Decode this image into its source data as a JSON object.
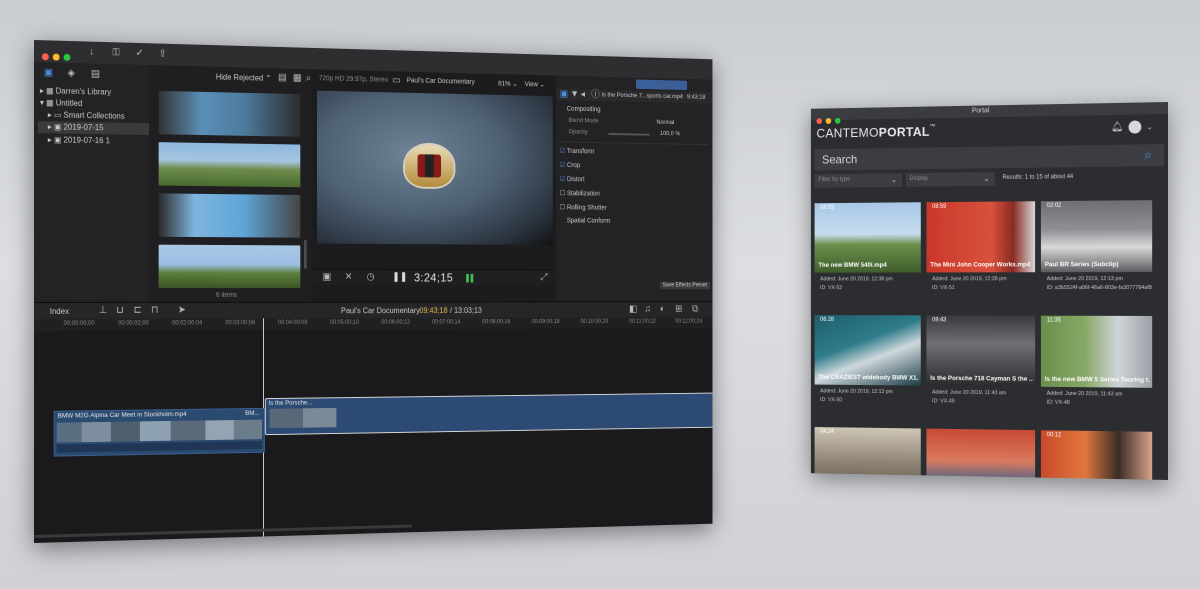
{
  "fcp": {
    "browser": {
      "filter_label": "Hide Rejected",
      "filter_chevron": "⌃",
      "library": "Darren's Library",
      "event_untitled": "Untitled",
      "smart_collections": "Smart Collections",
      "date1": "2019-07-15",
      "date2": "2019-07-16 1",
      "items_count": "6 items"
    },
    "viewer": {
      "format": "720p HD 29.97p, Stereo",
      "project": "Paul's Car Documentary",
      "zoom": "81%",
      "view": "View",
      "timecode": "3:24;15"
    },
    "inspector": {
      "clip_name": "Is the Porsche 7...sports car.mp4",
      "clip_time": "9:43;18",
      "compositing": "Compositing",
      "blend_mode_label": "Blend Mode",
      "blend_mode_value": "Normal",
      "opacity_label": "Opacity",
      "opacity_value": "100,0 %",
      "transform": "Transform",
      "crop": "Crop",
      "distort": "Distort",
      "stabilization": "Stabilization",
      "rolling_shutter": "Rolling Shutter",
      "spatial_conform": "Spatial Conform",
      "save_preset": "Save Effects Preset"
    },
    "timeline": {
      "index_label": "Index",
      "project": "Paul's Car Documentary",
      "position": "09:43;18",
      "duration": "/ 13:03;13",
      "ruler": [
        "00:00:00;00",
        "00:00:02;00",
        "00:02:00;04",
        "00:03:00;06",
        "00:04:00;08",
        "00:05:00;10",
        "00:06:00;12",
        "00:07:00;14",
        "00:08:00;16",
        "00:09:00;18",
        "00:10:00;20",
        "00:11:00;22",
        "00:12:00;24"
      ],
      "clip1": "BMW M2G Alpina Car Meet in Stockholm.mp4",
      "clip1_suffix": "BM...",
      "clip2": "Is the Porsche..."
    }
  },
  "portal": {
    "window_title": "Portal",
    "logo_a": "CANTEMO",
    "logo_b": "PORTAL",
    "logo_tm": "™",
    "search_placeholder": "Search",
    "filter_type": "Filter by type",
    "display": "Display",
    "results": "Results: 1 to 15 of about 44",
    "cards": [
      {
        "dur": "08:03",
        "title": "The new BMW 540i.mp4",
        "added": "Added: June 20 2019, 12:38 pm",
        "id": "ID: VX-52"
      },
      {
        "dur": "08:59",
        "title": "The Mini John Cooper Works.mp4",
        "added": "Added: June 20 2019, 12:28 pm",
        "id": "ID: VX-51"
      },
      {
        "dur": "02:02",
        "title": "Paul BR Series (Subclip)",
        "added": "Added: June 20 2019, 12:13 pm",
        "id": "ID: a3b5524f-a06f-46a6-803e-fa3077784af8"
      },
      {
        "dur": "06:28",
        "title": "The CRAZIEST widebody BMW X1...",
        "added": "Added: June 20 2019, 12:13 pm",
        "id": "ID: VX-50"
      },
      {
        "dur": "09:43",
        "title": "Is the Porsche 718 Cayman S the ...",
        "added": "Added: June 20 2019, 11:43 am",
        "id": "ID: VX-49"
      },
      {
        "dur": "11:35",
        "title": "Is the new BMW 5 Series Touring t...",
        "added": "Added: June 20 2019, 11:43 am",
        "id": "ID: VX-48"
      },
      {
        "dur": "04:24",
        "title": "",
        "added": "",
        "id": ""
      },
      {
        "dur": "",
        "title": "",
        "added": "",
        "id": ""
      },
      {
        "dur": "00:12",
        "title": "",
        "added": "",
        "id": ""
      }
    ]
  },
  "colors": {
    "fcp_bg": "#1d1d1f",
    "accent": "#4a6fa5",
    "clip_blue": "#2c4a73",
    "portal_bg": "#2b2d31",
    "search_icon": "#3b8fd8"
  }
}
